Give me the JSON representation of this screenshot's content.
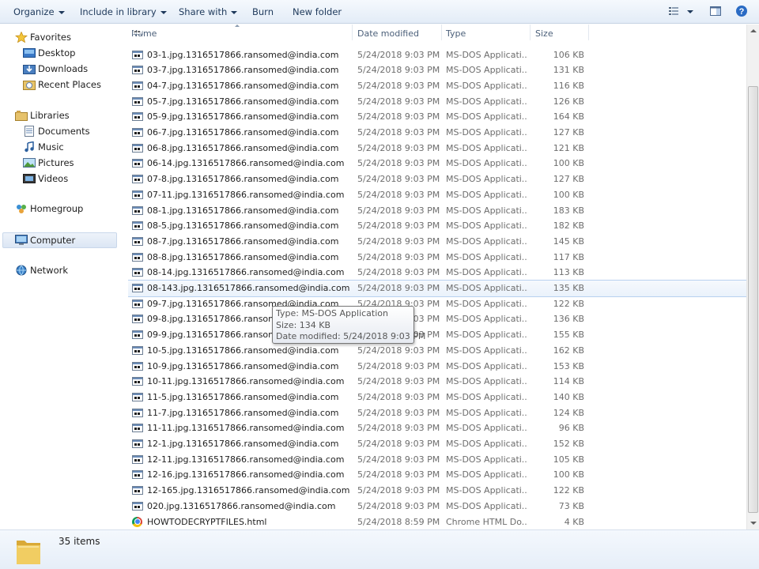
{
  "toolbar": {
    "organize": "Organize",
    "include_in_library": "Include in library",
    "share_with": "Share with",
    "burn": "Burn",
    "new_folder": "New folder"
  },
  "nav": {
    "favorites": "Favorites",
    "desktop": "Desktop",
    "downloads": "Downloads",
    "recent_places": "Recent Places",
    "libraries": "Libraries",
    "documents": "Documents",
    "music": "Music",
    "pictures": "Pictures",
    "videos": "Videos",
    "homegroup": "Homegroup",
    "computer": "Computer",
    "network": "Network"
  },
  "columns": {
    "name": "Name",
    "date_modified": "Date modified",
    "type": "Type",
    "size": "Size"
  },
  "files": [
    {
      "name": "03-1.jpg.1316517866.ransomed@india.com",
      "date": "5/24/2018 9:03 PM",
      "type": "MS-DOS Applicati...",
      "size": "106 KB",
      "icon": "exe-icon"
    },
    {
      "name": "03-7.jpg.1316517866.ransomed@india.com",
      "date": "5/24/2018 9:03 PM",
      "type": "MS-DOS Applicati...",
      "size": "131 KB",
      "icon": "exe-icon"
    },
    {
      "name": "04-7.jpg.1316517866.ransomed@india.com",
      "date": "5/24/2018 9:03 PM",
      "type": "MS-DOS Applicati...",
      "size": "116 KB",
      "icon": "exe-icon"
    },
    {
      "name": "05-7.jpg.1316517866.ransomed@india.com",
      "date": "5/24/2018 9:03 PM",
      "type": "MS-DOS Applicati...",
      "size": "126 KB",
      "icon": "exe-icon"
    },
    {
      "name": "05-9.jpg.1316517866.ransomed@india.com",
      "date": "5/24/2018 9:03 PM",
      "type": "MS-DOS Applicati...",
      "size": "164 KB",
      "icon": "exe-icon"
    },
    {
      "name": "06-7.jpg.1316517866.ransomed@india.com",
      "date": "5/24/2018 9:03 PM",
      "type": "MS-DOS Applicati...",
      "size": "127 KB",
      "icon": "exe-icon"
    },
    {
      "name": "06-8.jpg.1316517866.ransomed@india.com",
      "date": "5/24/2018 9:03 PM",
      "type": "MS-DOS Applicati...",
      "size": "121 KB",
      "icon": "exe-icon"
    },
    {
      "name": "06-14.jpg.1316517866.ransomed@india.com",
      "date": "5/24/2018 9:03 PM",
      "type": "MS-DOS Applicati...",
      "size": "100 KB",
      "icon": "exe-icon"
    },
    {
      "name": "07-8.jpg.1316517866.ransomed@india.com",
      "date": "5/24/2018 9:03 PM",
      "type": "MS-DOS Applicati...",
      "size": "127 KB",
      "icon": "exe-icon"
    },
    {
      "name": "07-11.jpg.1316517866.ransomed@india.com",
      "date": "5/24/2018 9:03 PM",
      "type": "MS-DOS Applicati...",
      "size": "100 KB",
      "icon": "exe-icon"
    },
    {
      "name": "08-1.jpg.1316517866.ransomed@india.com",
      "date": "5/24/2018 9:03 PM",
      "type": "MS-DOS Applicati...",
      "size": "183 KB",
      "icon": "exe-icon"
    },
    {
      "name": "08-5.jpg.1316517866.ransomed@india.com",
      "date": "5/24/2018 9:03 PM",
      "type": "MS-DOS Applicati...",
      "size": "182 KB",
      "icon": "exe-icon"
    },
    {
      "name": "08-7.jpg.1316517866.ransomed@india.com",
      "date": "5/24/2018 9:03 PM",
      "type": "MS-DOS Applicati...",
      "size": "145 KB",
      "icon": "exe-icon"
    },
    {
      "name": "08-8.jpg.1316517866.ransomed@india.com",
      "date": "5/24/2018 9:03 PM",
      "type": "MS-DOS Applicati...",
      "size": "117 KB",
      "icon": "exe-icon"
    },
    {
      "name": "08-14.jpg.1316517866.ransomed@india.com",
      "date": "5/24/2018 9:03 PM",
      "type": "MS-DOS Applicati...",
      "size": "113 KB",
      "icon": "exe-icon"
    },
    {
      "name": "08-143.jpg.1316517866.ransomed@india.com",
      "date": "5/24/2018 9:03 PM",
      "type": "MS-DOS Applicati...",
      "size": "135 KB",
      "icon": "exe-icon",
      "hover": true
    },
    {
      "name": "09-7.jpg.1316517866.ransomed@india.com",
      "date": "5/24/2018 9:03 PM",
      "type": "MS-DOS Applicati...",
      "size": "122 KB",
      "icon": "exe-icon"
    },
    {
      "name": "09-8.jpg.1316517866.ransomed@india.com",
      "date": "5/24/2018 9:03 PM",
      "type": "MS-DOS Applicati...",
      "size": "136 KB",
      "icon": "exe-icon"
    },
    {
      "name": "09-9.jpg.1316517866.ransomed@india.com",
      "date": "5/24/2018 9:03 PM",
      "type": "MS-DOS Applicati...",
      "size": "155 KB",
      "icon": "exe-icon"
    },
    {
      "name": "10-5.jpg.1316517866.ransomed@india.com",
      "date": "5/24/2018 9:03 PM",
      "type": "MS-DOS Applicati...",
      "size": "162 KB",
      "icon": "exe-icon"
    },
    {
      "name": "10-9.jpg.1316517866.ransomed@india.com",
      "date": "5/24/2018 9:03 PM",
      "type": "MS-DOS Applicati...",
      "size": "153 KB",
      "icon": "exe-icon"
    },
    {
      "name": "10-11.jpg.1316517866.ransomed@india.com",
      "date": "5/24/2018 9:03 PM",
      "type": "MS-DOS Applicati...",
      "size": "114 KB",
      "icon": "exe-icon"
    },
    {
      "name": "11-5.jpg.1316517866.ransomed@india.com",
      "date": "5/24/2018 9:03 PM",
      "type": "MS-DOS Applicati...",
      "size": "140 KB",
      "icon": "exe-icon"
    },
    {
      "name": "11-7.jpg.1316517866.ransomed@india.com",
      "date": "5/24/2018 9:03 PM",
      "type": "MS-DOS Applicati...",
      "size": "124 KB",
      "icon": "exe-icon"
    },
    {
      "name": "11-11.jpg.1316517866.ransomed@india.com",
      "date": "5/24/2018 9:03 PM",
      "type": "MS-DOS Applicati...",
      "size": "96 KB",
      "icon": "exe-icon"
    },
    {
      "name": "12-1.jpg.1316517866.ransomed@india.com",
      "date": "5/24/2018 9:03 PM",
      "type": "MS-DOS Applicati...",
      "size": "152 KB",
      "icon": "exe-icon"
    },
    {
      "name": "12-11.jpg.1316517866.ransomed@india.com",
      "date": "5/24/2018 9:03 PM",
      "type": "MS-DOS Applicati...",
      "size": "105 KB",
      "icon": "exe-icon"
    },
    {
      "name": "12-16.jpg.1316517866.ransomed@india.com",
      "date": "5/24/2018 9:03 PM",
      "type": "MS-DOS Applicati...",
      "size": "100 KB",
      "icon": "exe-icon"
    },
    {
      "name": "12-165.jpg.1316517866.ransomed@india.com",
      "date": "5/24/2018 9:03 PM",
      "type": "MS-DOS Applicati...",
      "size": "122 KB",
      "icon": "exe-icon"
    },
    {
      "name": "020.jpg.1316517866.ransomed@india.com",
      "date": "5/24/2018 9:03 PM",
      "type": "MS-DOS Applicati...",
      "size": "73 KB",
      "icon": "exe-icon"
    },
    {
      "name": "HOWTODECRYPTFILES.html",
      "date": "5/24/2018 8:59 PM",
      "type": "Chrome HTML Do...",
      "size": "4 KB",
      "icon": "chrome-icon"
    }
  ],
  "tooltip": {
    "type_line": "Type: MS-DOS Application",
    "size_line": "Size: 134 KB",
    "date_line": "Date modified: 5/24/2018 9:03 PM"
  },
  "status": {
    "item_count": "35 items"
  }
}
